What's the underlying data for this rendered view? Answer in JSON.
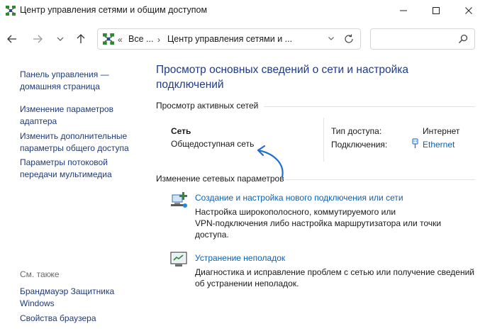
{
  "window": {
    "title": "Центр управления сетями и общим доступом",
    "minimize_glyph": "—",
    "maximize_glyph": "☐",
    "close_glyph": "✕"
  },
  "address": {
    "overflow": "«",
    "segment_1": "Все ...",
    "separator": "›",
    "segment_2": "Центр управления сетями и ...",
    "search_placeholder": ""
  },
  "sidebar": {
    "links": [
      "Панель управления —",
      "домашняя страница",
      "Изменение параметров",
      "адаптера",
      "Изменить дополнительные",
      "параметры общего доступа",
      "Параметры потоковой",
      "передачи мультимедиа"
    ],
    "see_also": "См. также",
    "see_also_links": [
      "Брандмауэр Защитника",
      "Windows",
      "Свойства браузера"
    ]
  },
  "main": {
    "title_line1": "Просмотр основных сведений о сети и настройка",
    "title_line2": "подключений",
    "active_networks_header": "Просмотр активных сетей",
    "network_label": "Сеть",
    "network_type": "Общедоступная сеть",
    "access_type_label": "Тип доступа:",
    "access_type_value": "Интернет",
    "connections_label": "Подключения:",
    "connection_value": "Ethernet",
    "change_header": "Изменение сетевых параметров",
    "tasks": [
      {
        "icon": "network-setup-icon",
        "title": "Создание и настройка нового подключения или сети",
        "desc": [
          "Настройка широкополосного, коммутируемого или",
          "VPN-подключения либо настройка маршрутизатора или точки",
          "доступа."
        ]
      },
      {
        "icon": "troubleshoot-icon",
        "title": "Устранение неполадок",
        "desc": [
          "Диагностика и исправление проблем с сетью или получение сведений",
          "об устранении неполадок."
        ]
      }
    ]
  },
  "colors": {
    "link": "#0e5fb0",
    "heading": "#1e3a8a",
    "annotation_arrow": "#1f6fd1"
  }
}
